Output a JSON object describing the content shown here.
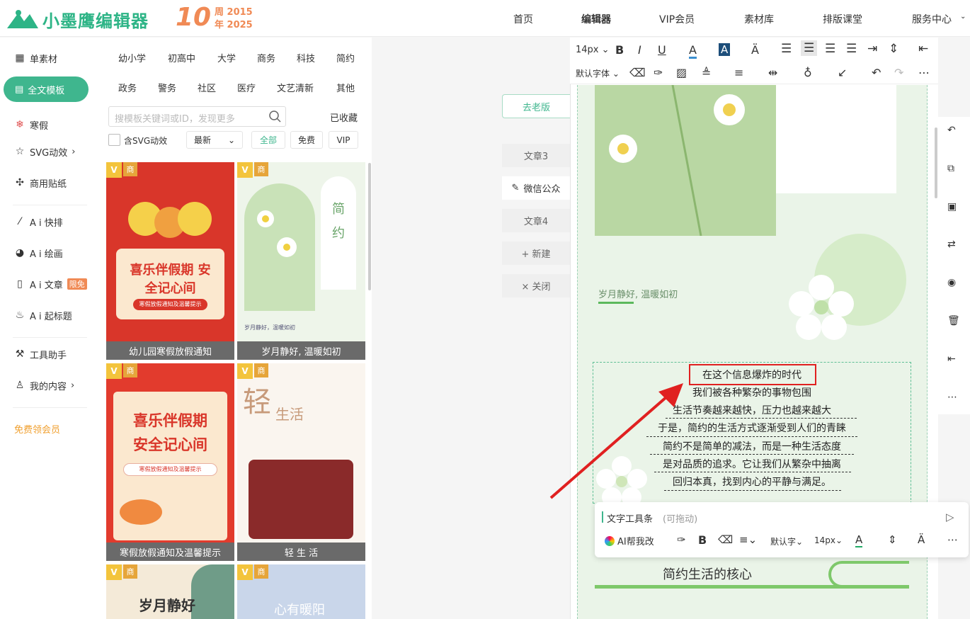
{
  "brand": {
    "name": "小墨鹰编辑器",
    "anniv_num": "10",
    "anniv_line1": "周 2015",
    "anniv_line2": "年 2025"
  },
  "nav": [
    "首页",
    "编辑器",
    "VIP会员",
    "素材库",
    "排版课堂",
    "服务中心"
  ],
  "sidebar": [
    {
      "label": "单素材",
      "icon": "grid-icon"
    },
    {
      "label": "全文模板",
      "icon": "layout-icon"
    },
    {
      "label": "寒假",
      "icon": "snow-icon"
    },
    {
      "label": "SVG动效",
      "icon": "star-icon"
    },
    {
      "label": "商用贴纸",
      "icon": "puzzle-icon"
    },
    {
      "label": "A i 快排",
      "icon": "ai-icon"
    },
    {
      "label": "A i 绘画",
      "icon": "palette-icon"
    },
    {
      "label": "A i 文章",
      "icon": "doc-icon",
      "badge": "限免"
    },
    {
      "label": "A i 起标题",
      "icon": "fire-icon"
    },
    {
      "label": "工具助手",
      "icon": "tool-icon"
    },
    {
      "label": "我的内容",
      "icon": "user-icon"
    },
    {
      "label": "免费领会员",
      "icon": ""
    }
  ],
  "categories_row1": [
    "幼小学",
    "初高中",
    "大学",
    "商务",
    "科技",
    "简约"
  ],
  "categories_row2": [
    "政务",
    "警务",
    "社区",
    "医疗",
    "文艺清新",
    "其他"
  ],
  "search": {
    "placeholder": "搜模板关键词或ID，发现更多",
    "favorites": "已收藏"
  },
  "filters": {
    "svg": "含SVG动效",
    "sort": "最新",
    "all": "全部",
    "free": "免费",
    "vip": "VIP"
  },
  "templates": [
    {
      "caption": "幼儿园寒假放假通知",
      "title": "喜乐伴假期 安全记心间",
      "sub": "寒假放假通知及温馨提示"
    },
    {
      "caption": "岁月静好, 温暖如初",
      "title": "简 约",
      "sub": "岁月静好，温暖如初"
    },
    {
      "caption": "寒假放假通知及温馨提示",
      "title": "喜乐伴假期 安全记心间",
      "sub": "寒假放假通知及温馨提示"
    },
    {
      "caption": "轻 生 活",
      "title": "轻",
      "sub": "生活"
    },
    {
      "caption": "",
      "title": "岁月静好",
      "sub": ""
    },
    {
      "caption": "",
      "title": "心有暖阳",
      "sub": ""
    }
  ],
  "badges": {
    "v": "V",
    "s": "商"
  },
  "tabs": {
    "old": "去老版",
    "t1": "文章3",
    "t2": "微信公众",
    "t3": "文章4",
    "new": "+ 新建",
    "close": "× 关闭"
  },
  "toolbar": {
    "size": "14px",
    "font": "默认字体"
  },
  "article": {
    "caption": "岁月静好, 温暖如初",
    "lines": [
      "在这个信息爆炸的时代",
      "我们被各种繁杂的事物包围",
      "生活节奏越来越快，压力也越来越大",
      "于是，简约的生活方式逐渐受到人们的青睐",
      "简约不是简单的减法，而是一种生活态度",
      "是对品质的追求。它让我们从繁杂中抽离",
      "回归本真，找到内心的平静与满足。"
    ],
    "section": "简约生活的核心"
  },
  "floatbar": {
    "title": "文字工具条",
    "drag": "(可拖动)",
    "ai": "AI帮我改",
    "font": "默认字",
    "size": "14px"
  },
  "colors": {
    "brand": "#2db486",
    "accent": "#3fb68e",
    "orange": "#f08a55",
    "red": "#e02020"
  }
}
